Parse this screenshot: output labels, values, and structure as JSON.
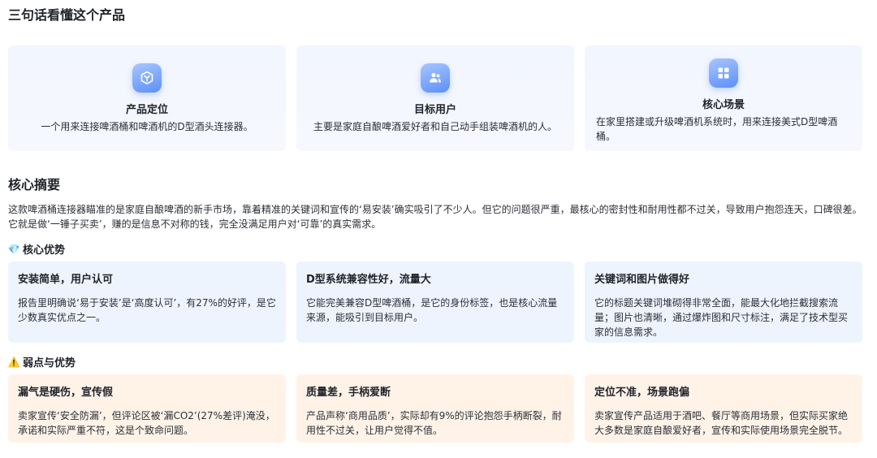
{
  "header": {
    "title": "三句话看懂这个产品"
  },
  "intro_cards": [
    {
      "icon": "cube-icon",
      "title": "产品定位",
      "desc": "一个用来连接啤酒桶和啤酒机的D型酒头连接器。"
    },
    {
      "icon": "users-icon",
      "title": "目标用户",
      "desc": "主要是家庭自酿啤酒爱好者和自己动手组装啤酒机的人。"
    },
    {
      "icon": "grid-icon",
      "title": "核心场景",
      "desc": "在家里搭建或升级啤酒机系统时，用来连接美式D型啤酒桶。"
    }
  ],
  "summary": {
    "title": "核心摘要",
    "text": "这款啤酒桶连接器瞄准的是家庭自酿啤酒的新手市场，靠着精准的关键词和宣传的‘易安装’确实吸引了不少人。但它的问题很严重，最核心的密封性和耐用性都不过关，导致用户抱怨连天，口碑很差。它就是做‘一锤子买卖’，赚的是信息不对称的钱，完全没满足用户对‘可靠’的真实需求。"
  },
  "advantages": {
    "emoji": "💎",
    "title": "核心优势",
    "items": [
      {
        "title": "安装简单，用户认可",
        "desc": "报告里明确说‘易于安装’是‘高度认可’，有27%的好评，是它少数真实优点之一。"
      },
      {
        "title": "D型系统兼容性好，流量大",
        "desc": "它能完美兼容D型啤酒桶，是它的身份标签，也是核心流量来源，能吸引到目标用户。"
      },
      {
        "title": "关键词和图片做得好",
        "desc": "它的标题关键词堆砌得非常全面，能最大化地拦截搜索流量；图片也清晰，通过爆炸图和尺寸标注，满足了技术型买家的信息需求。"
      }
    ]
  },
  "weaknesses": {
    "emoji": "⚠️",
    "title": "弱点与优势",
    "items": [
      {
        "title": "漏气是硬伤，宣传假",
        "desc": "卖家宣传‘安全防漏’，但评论区被‘漏CO2’(27%差评)淹没，承诺和实际严重不符，这是个致命问题。"
      },
      {
        "title": "质量差，手柄爱断",
        "desc": "产品声称‘商用品质’，实际却有9%的评论抱怨手柄断裂，耐用性不过关，让用户觉得不值。"
      },
      {
        "title": "定位不准，场景跑偏",
        "desc": "卖家宣传产品适用于酒吧、餐厅等商用场景，但实际买家绝大多数是家庭自酿爱好者，宣传和实际使用场景完全脱节。"
      }
    ]
  }
}
